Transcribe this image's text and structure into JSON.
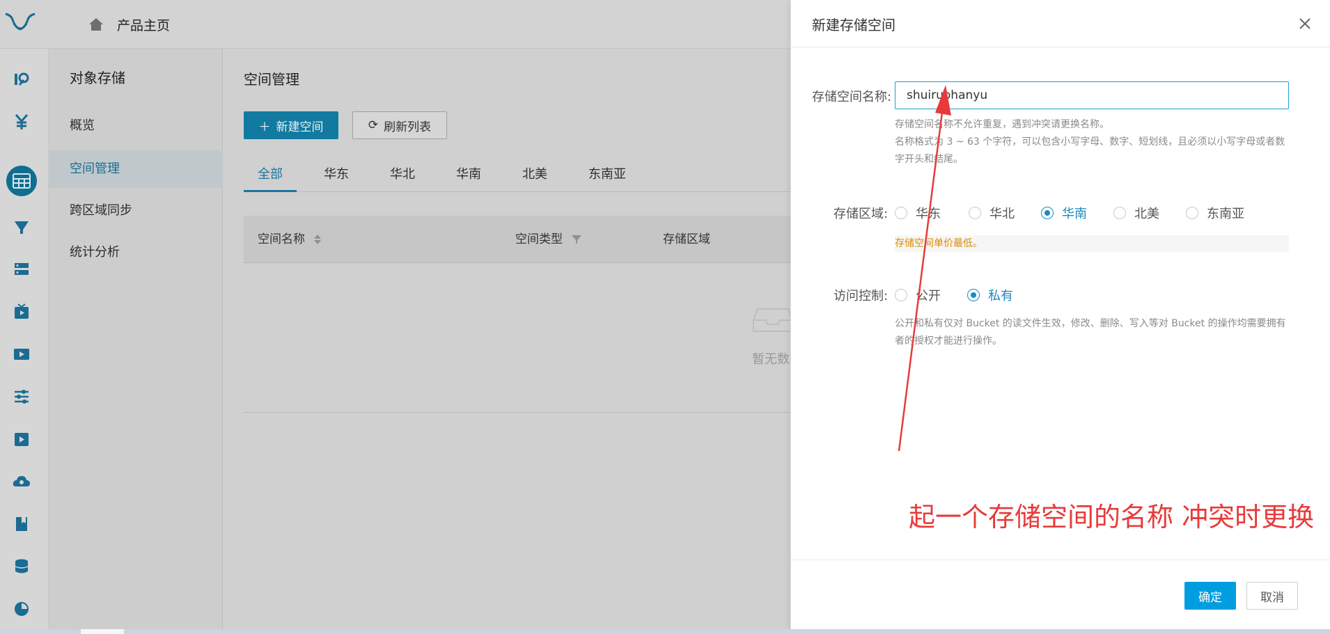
{
  "header": {
    "home_label": "产品主页"
  },
  "sidebar": {
    "title": "对象存储",
    "items": [
      {
        "label": "概览",
        "active": false
      },
      {
        "label": "空间管理",
        "active": true
      },
      {
        "label": "跨区域同步",
        "active": false
      },
      {
        "label": "统计分析",
        "active": false
      }
    ]
  },
  "main": {
    "title": "空间管理",
    "new_button": "新建空间",
    "refresh_button": "刷新列表",
    "tabs": [
      "全部",
      "华东",
      "华北",
      "华南",
      "北美",
      "东南亚"
    ],
    "active_tab": "全部",
    "columns": [
      "空间名称",
      "空间类型",
      "存储区域"
    ],
    "empty_text": "暂无数"
  },
  "drawer": {
    "title": "新建存储空间",
    "name_label": "存储空间名称:",
    "name_value": "shuiruohanyu",
    "name_hint_1": "存储空间名称不允许重复，遇到冲突请更换名称。",
    "name_hint_2": "名称格式为 3 ~ 63 个字符，可以包含小写字母、数字、短划线，且必须以小写字母或者数字开头和结尾。",
    "region_label": "存储区域:",
    "regions": [
      "华东",
      "华北",
      "华南",
      "北美",
      "东南亚"
    ],
    "selected_region": "华南",
    "region_note": "存储空间单价最低。",
    "access_label": "访问控制:",
    "access_options": [
      "公开",
      "私有"
    ],
    "selected_access": "私有",
    "access_hint": "公开和私有仅对 Bucket 的读文件生效，修改、删除、写入等对 Bucket 的操作均需要拥有者的授权才能进行操作。",
    "ok_button": "确定",
    "cancel_button": "取消"
  },
  "annotation": {
    "text": "起一个存储空间的名称 冲突时更换",
    "color": "#e83a3a"
  },
  "colors": {
    "accent": "#009ee0",
    "overlay_accent": "#127aa0",
    "warning": "#e08a00"
  }
}
